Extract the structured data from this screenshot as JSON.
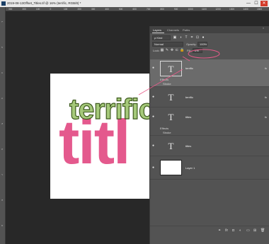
{
  "window": {
    "title": "2019-08-13Offset_Titles.tif @ 16% (terrific, RGB/8) *",
    "minimize": "—",
    "maximize": "☐",
    "close": "✕"
  },
  "rulers": {
    "top": [
      "300",
      "200",
      "100",
      "0",
      "100",
      "200",
      "300",
      "400",
      "500",
      "600",
      "700",
      "800",
      "900",
      "1000",
      "1100",
      "1200",
      "1300",
      "1400",
      "1500"
    ],
    "left": [
      "1",
      "2",
      "3",
      "4",
      "5",
      "6",
      "7",
      "8",
      "9"
    ]
  },
  "canvas": {
    "word1": "terrific",
    "word2": "titl",
    "colors": {
      "green_fill": "#a5c97a",
      "green_stroke": "#3d5a1d",
      "pink": "#e4598d",
      "annotation": "#e85b8a"
    }
  },
  "panel": {
    "tabs": [
      "Layers",
      "Channels",
      "Paths"
    ],
    "filter_label": "ρ Kind",
    "blend_mode": "Normal",
    "opacity_label": "Opacity:",
    "opacity_value": "100%",
    "lock_label": "Lock:",
    "fill_label": "Fill:",
    "fill_value": "0%",
    "layers": [
      {
        "name": "terrific",
        "thumb": "T",
        "fx": "fx",
        "effects_label": "Effects",
        "effect": "Stroke",
        "selected": true
      },
      {
        "name": "terrific",
        "thumb": "T",
        "fx": "fx"
      },
      {
        "name": "titles",
        "thumb": "T",
        "fx": "fx",
        "effects_label": "Effects",
        "effect": "Stroke"
      },
      {
        "name": "titles",
        "thumb": "T"
      },
      {
        "name": "Layer 1",
        "thumb": ""
      }
    ],
    "footer_icons": [
      "link-icon",
      "fx-icon",
      "mask-icon",
      "adjustment-icon",
      "folder-icon",
      "new-layer-icon",
      "trash-icon"
    ],
    "footer_glyphs": [
      "⚭",
      "fx",
      "◘",
      "◐",
      "▭",
      "⊞",
      "🗑"
    ]
  }
}
